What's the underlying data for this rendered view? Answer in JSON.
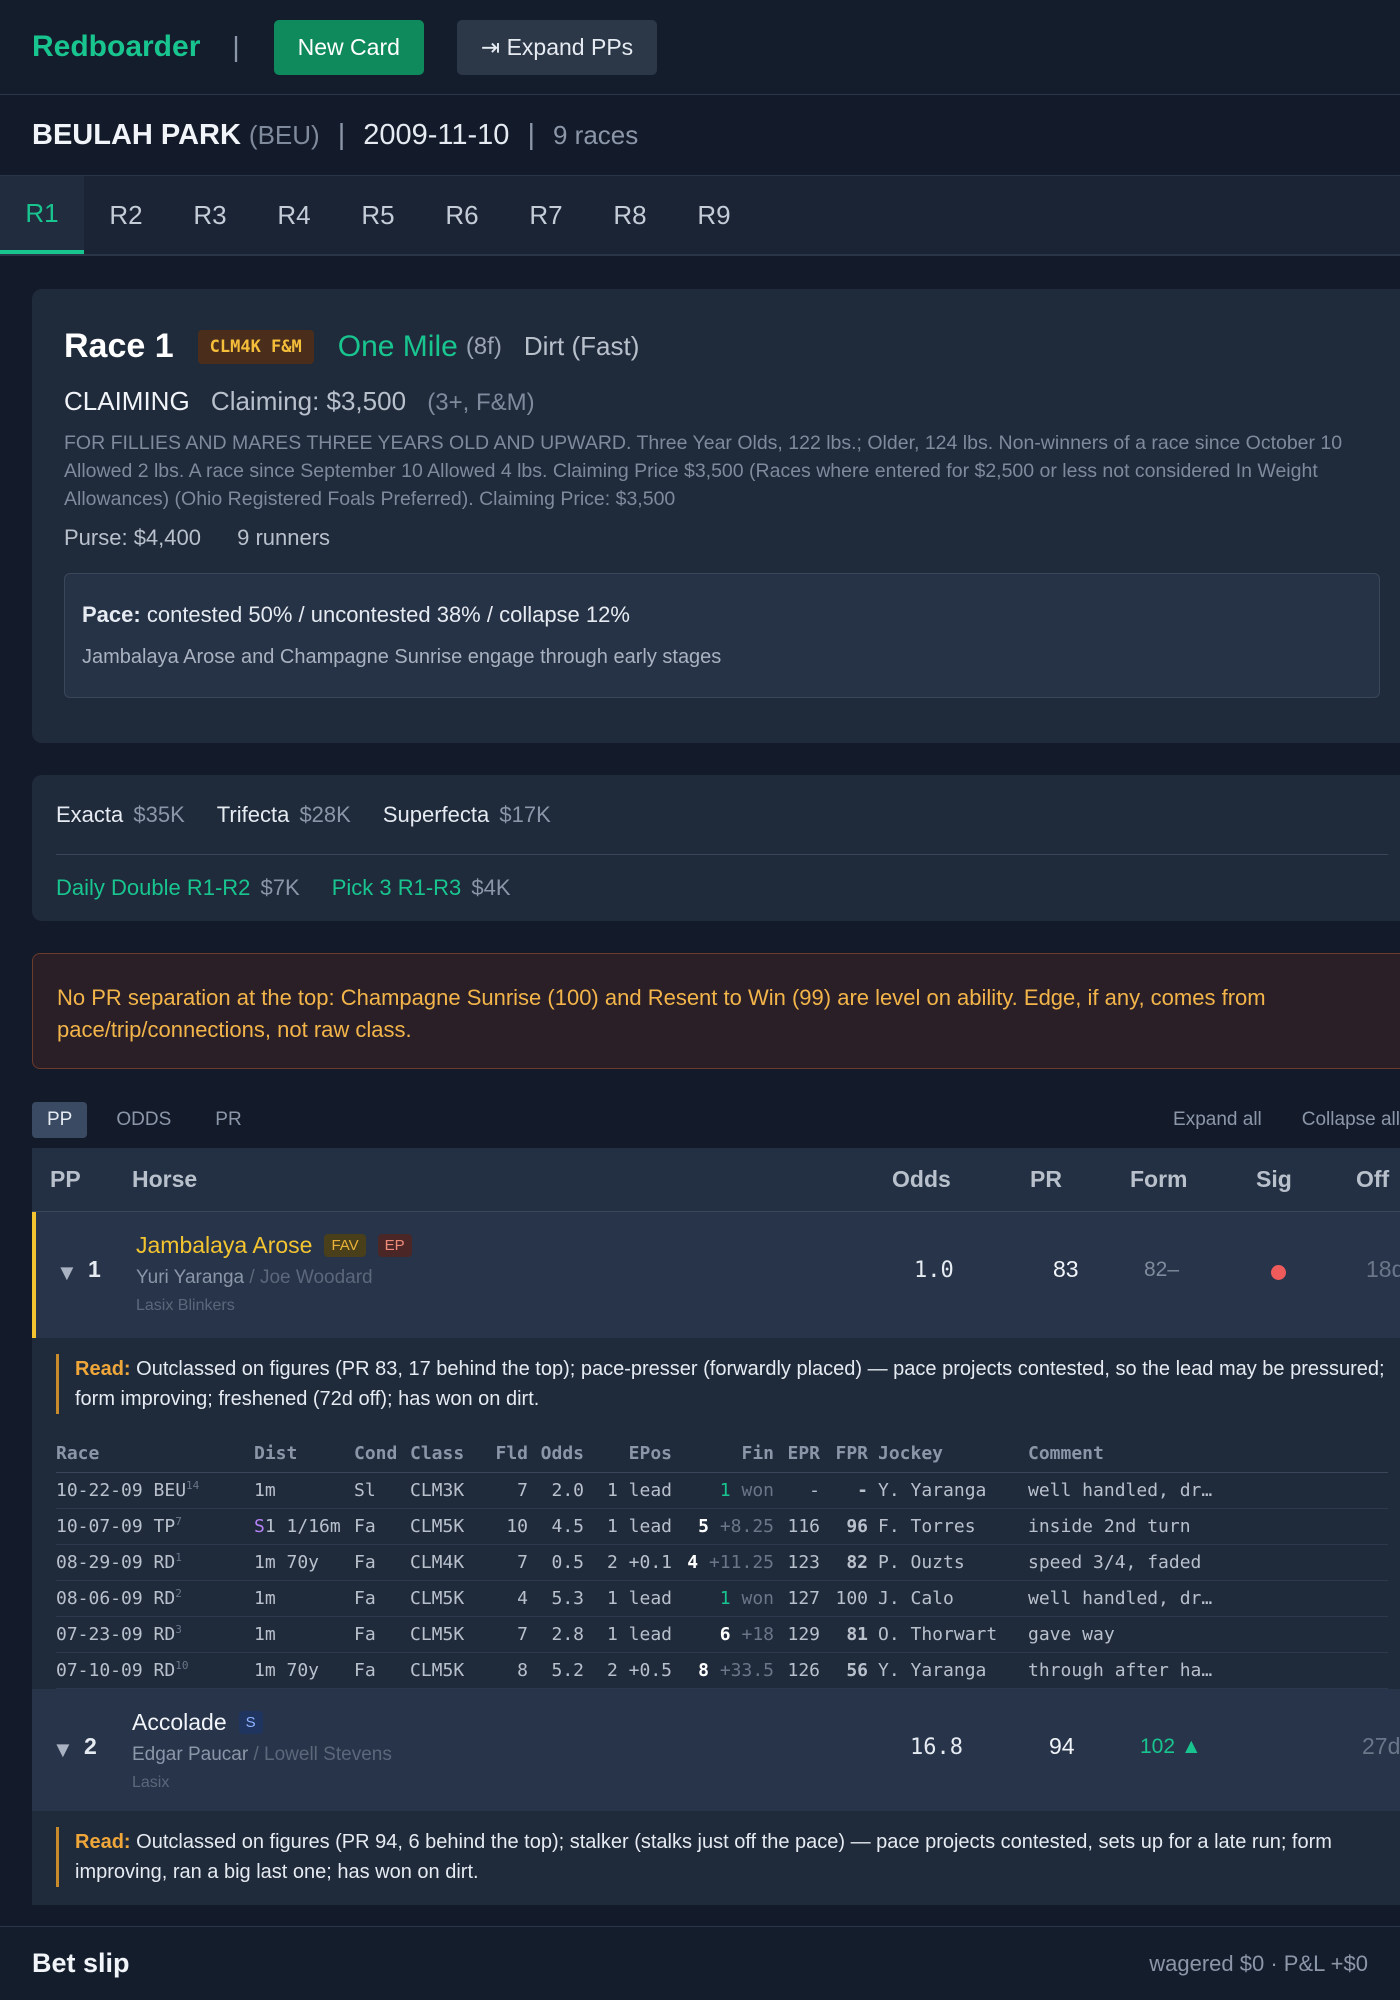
{
  "topbar": {
    "brand": "Redboarder",
    "sep": "|",
    "new_card": "New Card",
    "expand_pps": "⇥ Expand PPs"
  },
  "track": {
    "name": "BEULAH PARK",
    "code": "(BEU)",
    "date": "2009-11-10",
    "races": "9 races"
  },
  "tabs": [
    "R1",
    "R2",
    "R3",
    "R4",
    "R5",
    "R6",
    "R7",
    "R8",
    "R9"
  ],
  "race": {
    "title": "Race 1",
    "badge": "CLM4K F&M",
    "distance": "One Mile",
    "furlongs": "(8f)",
    "surface": "Dirt (Fast)",
    "type": "CLAIMING",
    "claiming": "Claiming: $3,500",
    "age": "(3+, F&M)",
    "conditions": "FOR FILLIES AND MARES THREE YEARS OLD AND UPWARD. Three Year Olds, 122 lbs.; Older, 124 lbs. Non-winners of a race since October 10 Allowed 2 lbs. A race since September 10 Allowed 4 lbs. Claiming Price $3,500 (Races where entered for $2,500 or less not considered In Weight Allowances) (Ohio Registered Foals Preferred). Claiming Price: $3,500",
    "purse": "Purse: $4,400",
    "runners": "9 runners",
    "pace_label": "Pace:",
    "pace": "contested 50% / uncontested 38% / collapse 12%",
    "pace_note": "Jambalaya Arose and Champagne Sunrise engage through early stages"
  },
  "exotics": {
    "row1": [
      {
        "name": "Exacta",
        "val": "$35K"
      },
      {
        "name": "Trifecta",
        "val": "$28K"
      },
      {
        "name": "Superfecta",
        "val": "$17K"
      }
    ],
    "row2": [
      {
        "name": "Daily Double R1-R2",
        "val": "$7K"
      },
      {
        "name": "Pick 3 R1-R3",
        "val": "$4K"
      }
    ]
  },
  "alert": "No PR separation at the top: Champagne Sunrise (100) and Resent to Win (99) are level on ability. Edge, if any, comes from pace/trip/connections, not raw class.",
  "controls": {
    "pp": "PP",
    "odds": "ODDS",
    "pr": "PR",
    "expand_all": "Expand all",
    "collapse_all": "Collapse all"
  },
  "table_head": {
    "pp": "PP",
    "horse": "Horse",
    "odds": "Odds",
    "pr": "PR",
    "form": "Form",
    "sig": "Sig",
    "off": "Off"
  },
  "horses": [
    {
      "caret": "▼",
      "pp": "1",
      "name": "Jambalaya Arose",
      "tags": [
        "FAV",
        "EP"
      ],
      "jockey": "Yuri Yaranga",
      "trainer": "/ Joe Woodard",
      "meds": "Lasix  Blinkers",
      "odds": "1.0",
      "pr": "83",
      "form": "82–",
      "off": "18d",
      "read_label": "Read:",
      "read": "Outclassed on figures (PR 83, 17 behind the top); pace-presser (forwardly placed) — pace projects contested, so the lead may be pressured; form improving; freshened (72d off); has won on dirt."
    },
    {
      "caret": "▼",
      "pp": "2",
      "name": "Accolade",
      "tags": [
        "S"
      ],
      "jockey": "Edgar Paucar",
      "trainer": "/ Lowell Stevens",
      "meds": "Lasix",
      "odds": "16.8",
      "pr": "94",
      "form": "102",
      "form_arrow": "▲",
      "off": "27d",
      "read_label": "Read:",
      "read": "Outclassed on figures (PR 94, 6 behind the top); stalker (stalks just off the pace) — pace projects contested, sets up for a late run; form improving, ran a big last one; has won on dirt."
    }
  ],
  "pp_head": [
    "Race",
    "Dist",
    "Cond",
    "Class",
    "Fld",
    "Odds",
    "EPos",
    "Fin",
    "EPR",
    "FPR",
    "Jockey",
    "Comment"
  ],
  "pp_rows": [
    {
      "date": "10-22-09 BEU",
      "sup": "14",
      "dist": "1m",
      "surf": "",
      "cond": "Sl",
      "class": "CLM3K",
      "fld": "7",
      "odds": "2.0",
      "epos": "1",
      "epos_m": "lead",
      "fin": "1",
      "fin_m": "won",
      "epr": "-",
      "fpr": "-",
      "jockey": "Y. Yaranga",
      "comment": "well handled, dr…"
    },
    {
      "date": "10-07-09 TP",
      "sup": "7",
      "dist": "1 1/16m",
      "surf": "S",
      "cond": "Fa",
      "class": "CLM5K",
      "fld": "10",
      "odds": "4.5",
      "epos": "1",
      "epos_m": "lead",
      "fin": "5",
      "fin_m": "+8.25",
      "epr": "116",
      "fpr": "96",
      "jockey": "F. Torres",
      "comment": "inside 2nd turn"
    },
    {
      "date": "08-29-09 RD",
      "sup": "1",
      "dist": "1m 70y",
      "surf": "",
      "cond": "Fa",
      "class": "CLM4K",
      "fld": "7",
      "odds": "0.5",
      "epos": "2",
      "epos_m": "+0.1",
      "fin": "4",
      "fin_m": "+11.25",
      "epr": "123",
      "fpr": "82",
      "jockey": "P. Ouzts",
      "comment": "speed 3/4, faded"
    },
    {
      "date": "08-06-09 RD",
      "sup": "2",
      "dist": "1m",
      "surf": "",
      "cond": "Fa",
      "class": "CLM5K",
      "fld": "4",
      "odds": "5.3",
      "epos": "1",
      "epos_m": "lead",
      "fin": "1",
      "fin_m": "won",
      "epr": "127",
      "fpr": "100",
      "jockey": "J. Calo",
      "comment": "well handled, dr…"
    },
    {
      "date": "07-23-09 RD",
      "sup": "3",
      "dist": "1m",
      "surf": "",
      "cond": "Fa",
      "class": "CLM5K",
      "fld": "7",
      "odds": "2.8",
      "epos": "1",
      "epos_m": "lead",
      "fin": "6",
      "fin_m": "+18",
      "epr": "129",
      "fpr": "81",
      "jockey": "O. Thorwart",
      "comment": "gave way"
    },
    {
      "date": "07-10-09 RD",
      "sup": "10",
      "dist": "1m 70y",
      "surf": "",
      "cond": "Fa",
      "class": "CLM5K",
      "fld": "8",
      "odds": "5.2",
      "epos": "2",
      "epos_m": "+0.5",
      "fin": "8",
      "fin_m": "+33.5",
      "epr": "126",
      "fpr": "56",
      "jockey": "Y. Yaranga",
      "comment": "through after ha…"
    }
  ],
  "betslip": {
    "title": "Bet slip",
    "info": "wagered $0 · P&L +$0"
  }
}
